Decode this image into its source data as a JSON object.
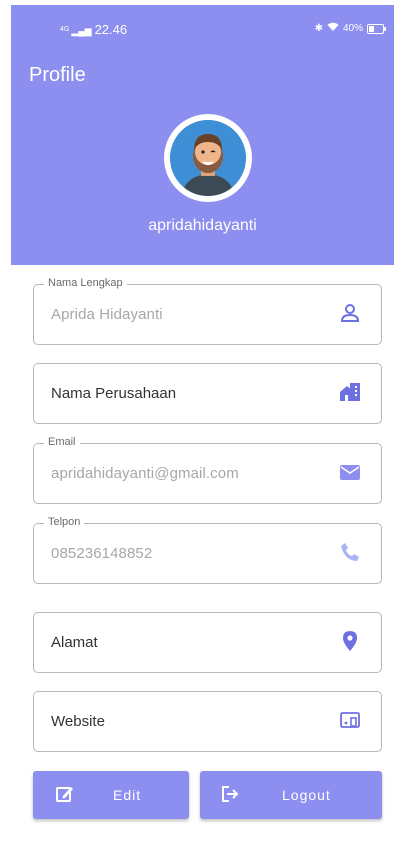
{
  "status_bar": {
    "network": "4G",
    "time": "22.46",
    "battery": "40%",
    "battery_level": 0.4
  },
  "app_bar": {
    "title": "Profile"
  },
  "profile": {
    "username": "apridahidayanti"
  },
  "fields": {
    "nama_lengkap": {
      "label": "Nama Lengkap",
      "value": "Aprida Hidayanti",
      "icon": "person-icon"
    },
    "nama_perusahaan": {
      "placeholder": "Nama Perusahaan",
      "icon": "company-icon"
    },
    "email": {
      "label": "Email",
      "value": "apridahidayanti@gmail.com",
      "icon": "mail-icon"
    },
    "telpon": {
      "label": "Telpon",
      "value": "085236148852",
      "icon": "phone-icon"
    },
    "alamat": {
      "placeholder": "Alamat",
      "icon": "location-icon"
    },
    "website": {
      "placeholder": "Website",
      "icon": "devices-icon"
    }
  },
  "actions": {
    "edit_label": "Edit",
    "logout_label": "Logout"
  },
  "colors": {
    "primary": "#8c8ef0",
    "primary_light": "#a9b4f5",
    "border": "#b8b8b8"
  }
}
